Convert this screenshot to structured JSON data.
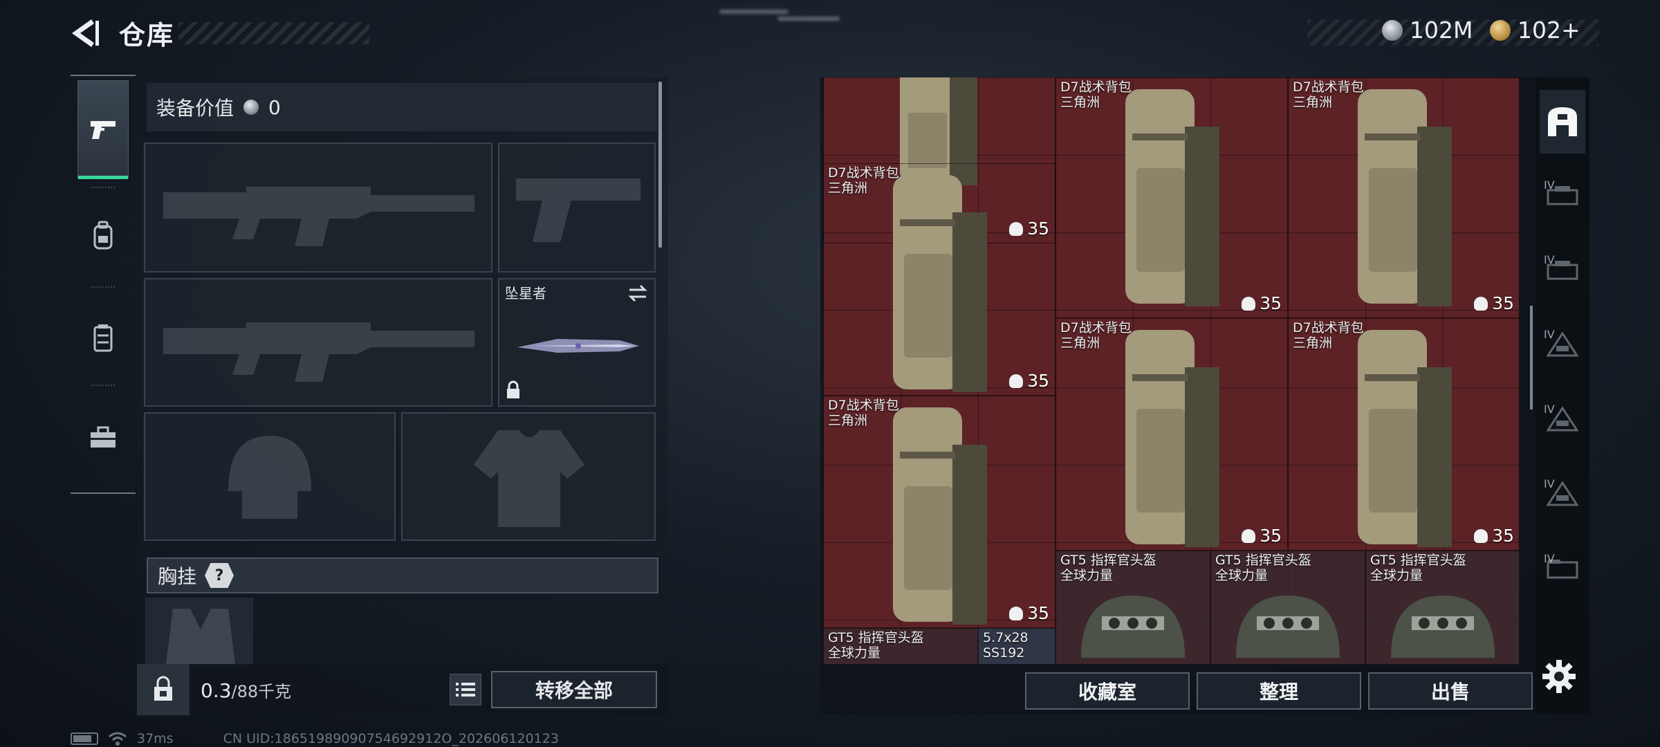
{
  "header": {
    "title": "仓库",
    "currencies": [
      {
        "icon": "silver-coin-icon",
        "value": "102M"
      },
      {
        "icon": "gold-coin-icon",
        "value": "102+"
      }
    ]
  },
  "side_nav": {
    "items": [
      {
        "icon": "pistol-icon",
        "active": true
      },
      {
        "icon": "backpack-icon",
        "active": false
      },
      {
        "icon": "chest-rig-icon",
        "active": false
      },
      {
        "icon": "toolbox-icon",
        "active": false
      }
    ]
  },
  "equipment": {
    "value_label": "装备价值",
    "value": "0",
    "melee_name": "坠星者",
    "chest_label": "胸挂",
    "help": "?"
  },
  "bottom_left": {
    "weight_current": "0.3",
    "weight_limit": "/88千克",
    "transfer_all": "转移全部"
  },
  "stash": {
    "items": [
      {
        "name": "",
        "sub": "",
        "count": "35"
      },
      {
        "name": "D7战术背包",
        "sub": "三角洲",
        "count": "35"
      },
      {
        "name": "D7战术背包",
        "sub": "三角洲",
        "count": "35"
      },
      {
        "name": "D7战术背包",
        "sub": "三角洲",
        "count": "35"
      },
      {
        "name": "D7战术背包",
        "sub": "三角洲",
        "count": "35"
      },
      {
        "name": "D7战术背包",
        "sub": "三角洲",
        "count": "35"
      },
      {
        "name": "D7战术背包",
        "sub": "三角洲",
        "count": "35"
      },
      {
        "name": "GT5 指挥官头盔",
        "sub": "全球力量",
        "count": ""
      },
      {
        "name": "GT5 指挥官头盔",
        "sub": "全球力量",
        "count": ""
      },
      {
        "name": "GT5 指挥官头盔",
        "sub": "全球力量",
        "count": ""
      },
      {
        "name": "GT5 指挥官头盔",
        "sub": "全球力量",
        "count": ""
      },
      {
        "name": "5.7x28",
        "sub": "SS192",
        "count": ""
      }
    ],
    "side_tabs": [
      {
        "icon": "stash-home-icon",
        "level": ""
      },
      {
        "icon": "container-tab-icon",
        "level": "IV"
      },
      {
        "icon": "container-tab-icon",
        "level": "IV"
      },
      {
        "icon": "container-tab-icon",
        "level": "IV"
      },
      {
        "icon": "container-tab-icon",
        "level": "IV"
      },
      {
        "icon": "container-tab-icon",
        "level": "IV"
      },
      {
        "icon": "container-tab-icon",
        "level": "IV"
      }
    ],
    "actions": {
      "collection": "收藏室",
      "organize": "整理",
      "sell": "出售"
    }
  },
  "status": {
    "ping": "37ms",
    "uid": "CN UID:18651989090754692912O_202606120123"
  },
  "colors": {
    "accent_green": "#3ad59a",
    "stash_red": "#5c2226"
  }
}
